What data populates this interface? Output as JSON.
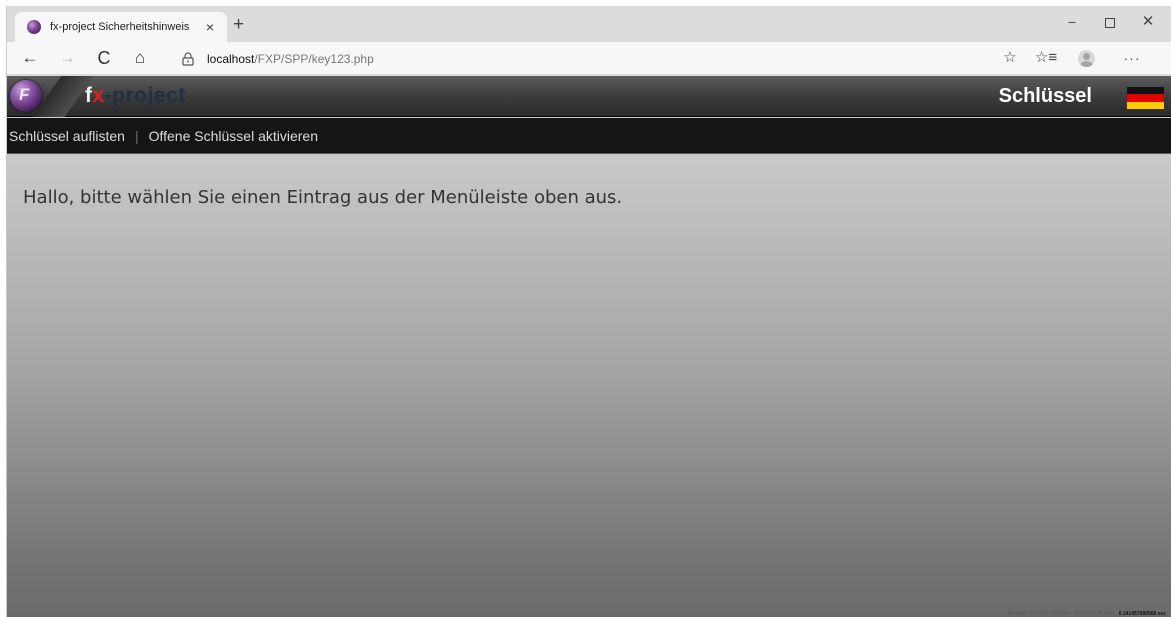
{
  "browser": {
    "tab_title": "fx-project Sicherheitshinweis",
    "tab_close": "×",
    "new_tab": "+",
    "url_host": "localhost",
    "url_path": "/FXP/SPP/key123.php",
    "window_controls": {
      "minimize": "−",
      "close": "✕"
    },
    "toolbar": {
      "back": "←",
      "forward": "→",
      "reload": "C",
      "home": "⌂",
      "favorites": "☆",
      "favorites_list": "☆≡",
      "more": "···"
    }
  },
  "header": {
    "brand_f": "f",
    "brand_x": "x",
    "brand_rest": "-project",
    "page_title": "Schlüssel",
    "flag": "german-flag"
  },
  "menu": {
    "items": [
      {
        "label": "Schlüssel auflisten"
      },
      {
        "label": "Offene Schlüssel aktivieren"
      }
    ],
    "separator": "|"
  },
  "content": {
    "welcome_text": "Hallo, bitte wählen Sie einen Eintrag aus der Menüleiste oben aus."
  },
  "footer": {
    "stats": "Runtime: 1617307738.3537 - 1617307738.3539",
    "stats_bold": "0.141457090568 sec"
  },
  "colors": {
    "menubar": "#151515",
    "brand_accent": "#e02020",
    "flag_black": "#111111",
    "flag_red": "#e30000",
    "flag_gold": "#ffcc00"
  }
}
